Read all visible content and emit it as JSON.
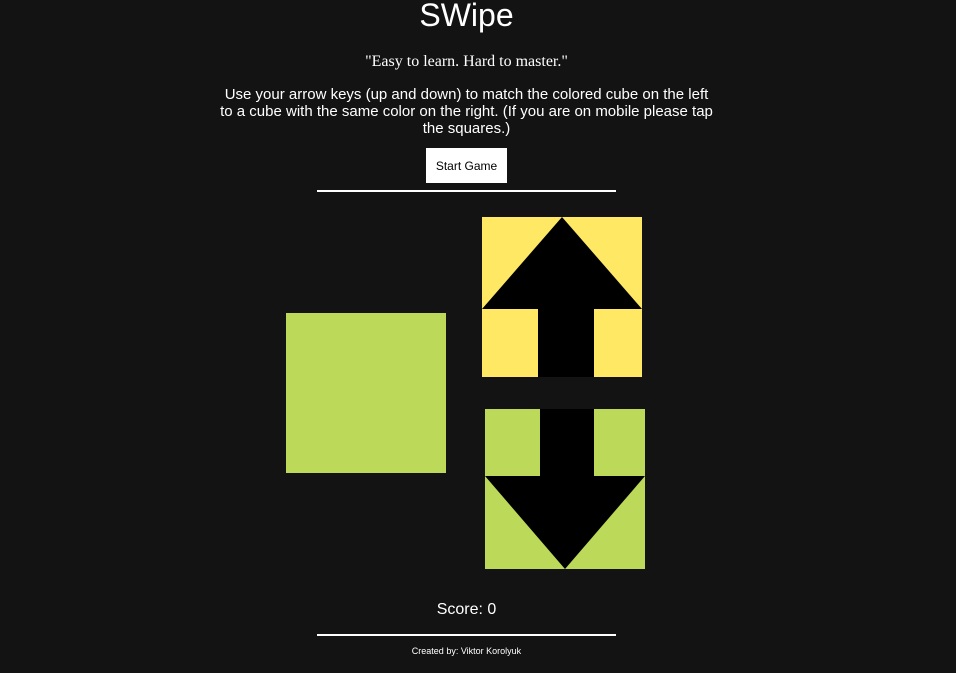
{
  "header": {
    "title": "SWipe",
    "tagline": "\"Easy to learn. Hard to master.\"",
    "instructions": "Use your arrow keys (up and down) to match the colored cube on the left to a cube with the same color on the right. (If you are on mobile please tap the squares.)"
  },
  "controls": {
    "start_label": "Start Game"
  },
  "game": {
    "player_color": "#bdd95a",
    "up_cube_color": "#ffe863",
    "down_cube_color": "#bdd95a",
    "arrow_color": "#000000",
    "up_icon": "arrow-up-icon",
    "down_icon": "arrow-down-icon"
  },
  "score": {
    "label": "Score: 0"
  },
  "footer": {
    "credits": "Created by: Viktor Korolyuk"
  }
}
